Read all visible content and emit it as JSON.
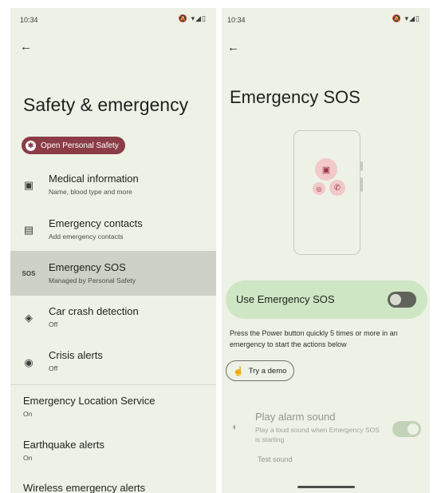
{
  "left": {
    "status": {
      "time": "10:34",
      "icons": "🔕 ▾◢▯"
    },
    "back_icon": "←",
    "title": "Safety & emergency",
    "open_button": {
      "label": "Open Personal Safety",
      "icon": "✱"
    },
    "items": [
      {
        "title": "Medical information",
        "subtitle": "Name, blood type and more",
        "icon": "▣"
      },
      {
        "title": "Emergency contacts",
        "subtitle": "Add emergency contacts",
        "icon": "▤"
      },
      {
        "title": "Emergency SOS",
        "subtitle": "Managed by Personal Safety",
        "icon": "SOS"
      },
      {
        "title": "Car crash detection",
        "subtitle": "Off",
        "icon": "◈"
      },
      {
        "title": "Crisis alerts",
        "subtitle": "Off",
        "icon": "◉"
      }
    ],
    "plain_items": [
      {
        "title": "Emergency Location Service",
        "subtitle": "On"
      },
      {
        "title": "Earthquake alerts",
        "subtitle": "On"
      },
      {
        "title": "Wireless emergency alerts",
        "subtitle": ""
      }
    ]
  },
  "right": {
    "status": {
      "time": "10:34",
      "icons": "🔕 ▾◢▯"
    },
    "back_icon": "←",
    "title": "Emergency SOS",
    "illustration_icons": {
      "video": "▣",
      "signal": "◎",
      "call": "✆"
    },
    "use_sos": {
      "label": "Use Emergency SOS",
      "enabled": false
    },
    "description": "Press the Power button quickly 5 times or more in an emergency to start the actions below",
    "demo_button": {
      "label": "Try a demo",
      "icon": "☝"
    },
    "alarm": {
      "title": "Play alarm sound",
      "subtitle": "Play a loud sound when Emergency SOS is starting",
      "test": "Test sound",
      "icon": "◖",
      "enabled": true
    }
  },
  "colors": {
    "background": "#eef1e6",
    "pill": "#8b3c46",
    "highlight_row": "#cdd1c6",
    "toggle_card": "#cfe6c4",
    "switch_off": "#5f635b",
    "sos_accent": "#f2c9c9"
  }
}
